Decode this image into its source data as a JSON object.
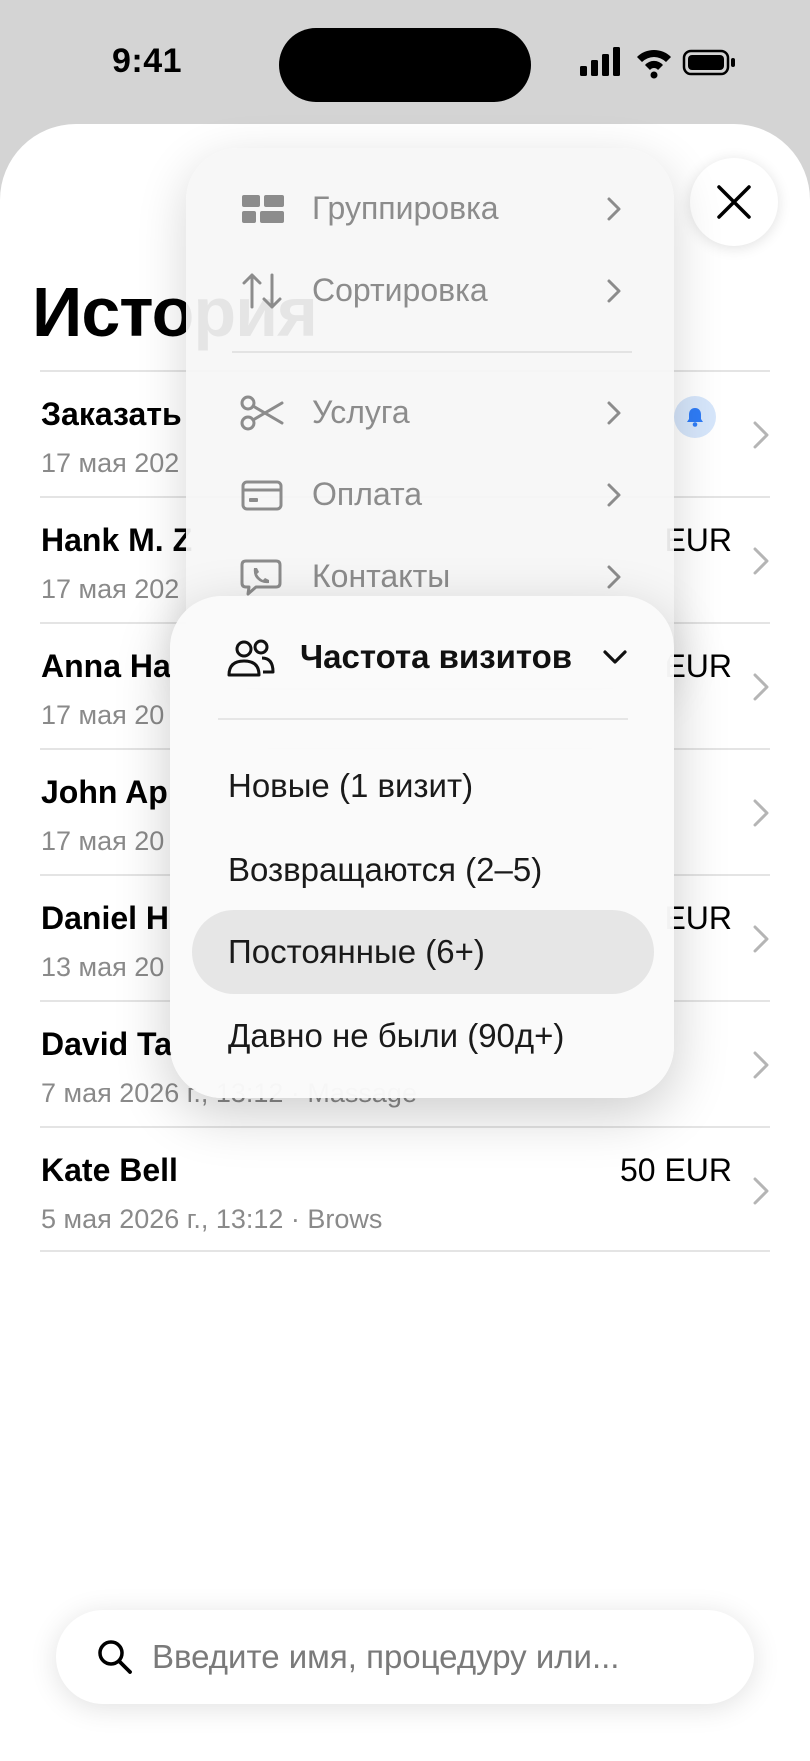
{
  "status_bar": {
    "time": "9:41"
  },
  "page": {
    "title": "История",
    "close_label": "Закрыть"
  },
  "list": [
    {
      "title": "Заказать",
      "subtitle": "17 мая 202",
      "amount": "",
      "has_bell": true
    },
    {
      "title": "Hank M. Z",
      "subtitle": "17 мая 202",
      "amount": "EUR",
      "has_bell": false
    },
    {
      "title": "Anna Ha",
      "subtitle": "17 мая 20",
      "amount": "EUR",
      "has_bell": false
    },
    {
      "title": "John Ap",
      "subtitle": "17 мая 20",
      "amount": "",
      "has_bell": false
    },
    {
      "title": "Daniel H",
      "subtitle": "13 мая 20",
      "amount": "EUR",
      "has_bell": false
    },
    {
      "title": "David Ta",
      "subtitle": "7 мая 2026 г., 13:12 · Massage",
      "amount": "",
      "has_bell": false
    },
    {
      "title": "Kate Bell",
      "subtitle": "5 мая 2026 г., 13:12 · Brows",
      "amount": "50 EUR",
      "has_bell": false
    }
  ],
  "menu_main": {
    "items": [
      {
        "label": "Группировка",
        "icon": "grouping-icon"
      },
      {
        "label": "Сортировка",
        "icon": "sort-icon"
      },
      {
        "label": "Услуга",
        "icon": "scissors-icon"
      },
      {
        "label": "Оплата",
        "icon": "card-icon"
      },
      {
        "label": "Контакты",
        "icon": "chat-phone-icon"
      }
    ]
  },
  "menu_visits": {
    "title": "Частота визитов",
    "options": [
      {
        "label": "Новые (1 визит)",
        "selected": false
      },
      {
        "label": "Возвращаются (2–5)",
        "selected": false
      },
      {
        "label": "Постоянные (6+)",
        "selected": true
      },
      {
        "label": "Давно не были (90д+)",
        "selected": false
      }
    ]
  },
  "search": {
    "placeholder": "Введите имя, процедуру или..."
  },
  "colors": {
    "accent": "#2f7cf6",
    "bell_badge_bg": "#d6e6fb",
    "selected_option_bg": "#e6e6e6"
  }
}
